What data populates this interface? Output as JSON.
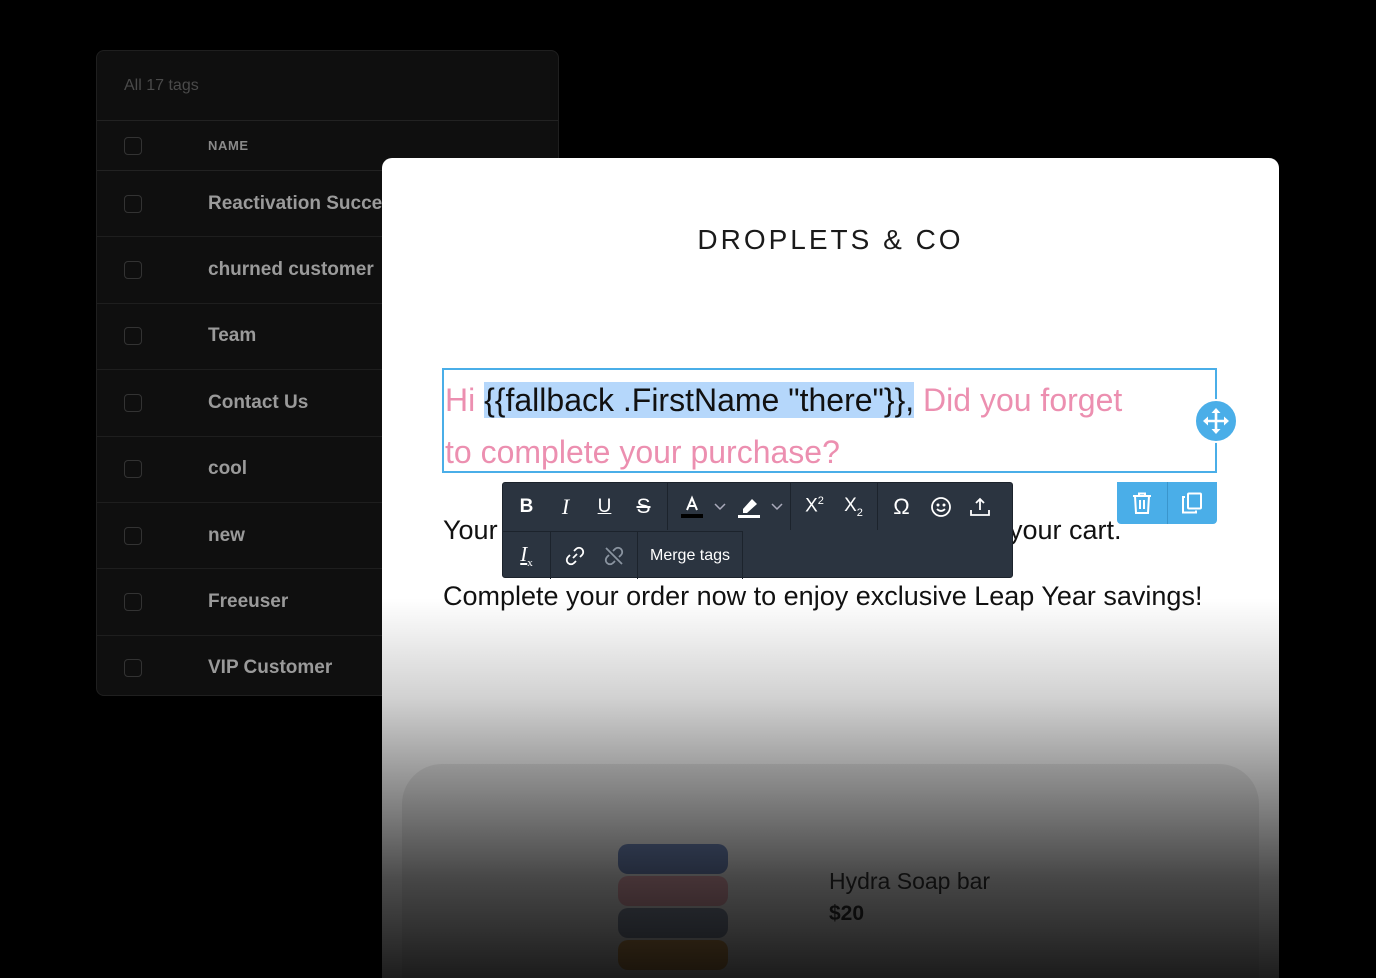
{
  "tags": {
    "header": "All 17 tags",
    "column_name": "NAME",
    "rows": [
      {
        "name": "Reactivation Success"
      },
      {
        "name": "churned customer"
      },
      {
        "name": "Team"
      },
      {
        "name": "Contact Us"
      },
      {
        "name": "cool"
      },
      {
        "name": "new"
      },
      {
        "name": "Freeuser"
      },
      {
        "name": "VIP Customer"
      }
    ]
  },
  "email": {
    "brand": "DROPLETS & CO",
    "heading": {
      "prefix": "Hi ",
      "merge_tag": "{{fallback .FirstName \"there\"}},",
      "suffix": " Did you forget to complete your purchase?"
    },
    "para1_left": "Your",
    "para1_right": "your cart.",
    "para2": "Complete your order now to enjoy exclusive Leap Year savings!",
    "product": {
      "name": "Hydra Soap bar",
      "price": "$20"
    }
  },
  "toolbar": {
    "merge_tags_label": "Merge tags",
    "icons": [
      "bold-icon",
      "italic-icon",
      "underline-icon",
      "strikethrough-icon",
      "font-color-icon",
      "highlight-icon",
      "superscript-icon",
      "subscript-icon",
      "special-char-icon",
      "emoji-icon",
      "upload-icon",
      "clear-format-icon",
      "link-icon",
      "unlink-icon"
    ]
  },
  "colors": {
    "accent": "#4aaee8",
    "heading_pink": "#ec8fb0",
    "selection": "#b5d7fb",
    "toolbar_bg": "#2b3440"
  }
}
